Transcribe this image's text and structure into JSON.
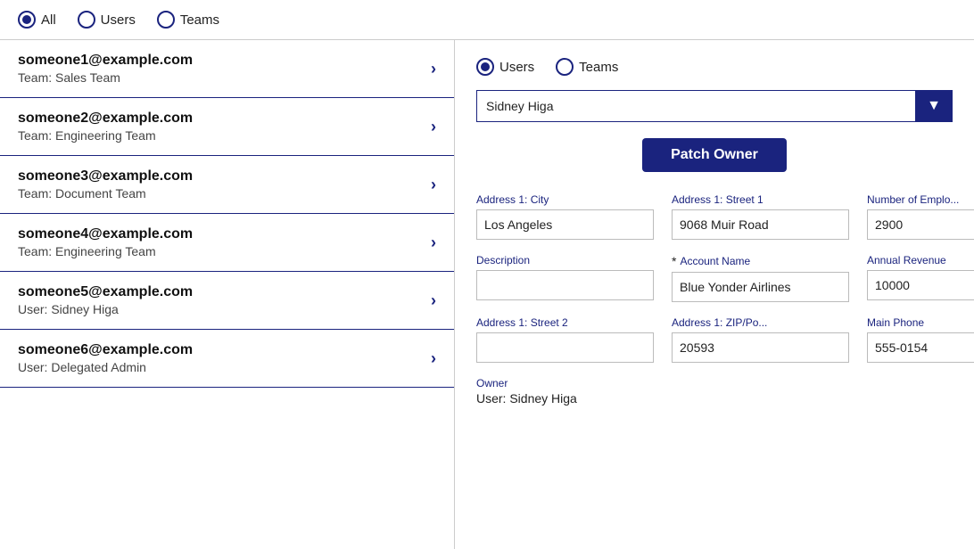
{
  "topBar": {
    "filters": [
      {
        "id": "all",
        "label": "All",
        "selected": true
      },
      {
        "id": "users",
        "label": "Users",
        "selected": false
      },
      {
        "id": "teams",
        "label": "Teams",
        "selected": false
      }
    ]
  },
  "leftPanel": {
    "items": [
      {
        "email": "someone1@example.com",
        "sub": "Team: Sales Team"
      },
      {
        "email": "someone2@example.com",
        "sub": "Team: Engineering Team"
      },
      {
        "email": "someone3@example.com",
        "sub": "Team: Document Team"
      },
      {
        "email": "someone4@example.com",
        "sub": "Team: Engineering Team"
      },
      {
        "email": "someone5@example.com",
        "sub": "User: Sidney Higa"
      },
      {
        "email": "someone6@example.com",
        "sub": "User: Delegated Admin"
      }
    ]
  },
  "rightPanel": {
    "filters": [
      {
        "id": "users",
        "label": "Users",
        "selected": true
      },
      {
        "id": "teams",
        "label": "Teams",
        "selected": false
      }
    ],
    "dropdown": {
      "value": "Sidney Higa",
      "placeholder": "Sidney Higa"
    },
    "patchOwnerButton": "Patch Owner",
    "fields": [
      {
        "id": "addr1city",
        "label": "Address 1: City",
        "value": "Los Angeles",
        "required": false
      },
      {
        "id": "addr1street1",
        "label": "Address 1: Street 1",
        "value": "9068 Muir Road",
        "required": false
      },
      {
        "id": "numemplo",
        "label": "Number of Emplo...",
        "value": "2900",
        "required": false
      },
      {
        "id": "description",
        "label": "Description",
        "value": "",
        "required": false
      },
      {
        "id": "accountname",
        "label": "Account Name",
        "value": "Blue Yonder Airlines",
        "required": true
      },
      {
        "id": "annualrevenue",
        "label": "Annual Revenue",
        "value": "10000",
        "required": false
      },
      {
        "id": "addr1street2",
        "label": "Address 1: Street 2",
        "value": "",
        "required": false
      },
      {
        "id": "addr1zip",
        "label": "Address 1: ZIP/Po...",
        "value": "20593",
        "required": false
      },
      {
        "id": "mainphone",
        "label": "Main Phone",
        "value": "555-0154",
        "required": false
      }
    ],
    "owner": {
      "label": "Owner",
      "value": "User: Sidney Higa"
    }
  },
  "icons": {
    "chevron": "›",
    "dropdownArrow": "▼"
  }
}
